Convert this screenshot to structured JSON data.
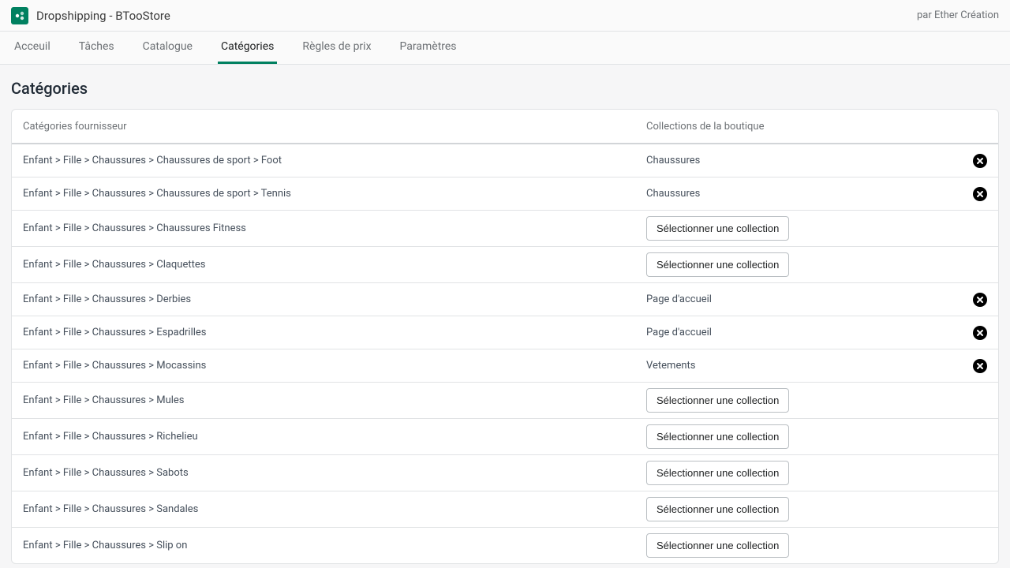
{
  "header": {
    "app_title": "Dropshipping - BTooStore",
    "author": "par Ether Création"
  },
  "tabs": [
    "Acceuil",
    "Tâches",
    "Catalogue",
    "Catégories",
    "Règles de prix",
    "Paramètres"
  ],
  "page_title": "Catégories",
  "columns": {
    "supplier": "Catégories fournisseur",
    "collection": "Collections de la boutique"
  },
  "select_label": "Sélectionner une collection",
  "rows": [
    {
      "supplier": "Enfant > Fille > Chaussures > Chaussures de sport > Foot",
      "collection": "Chaussures",
      "has_remove": true
    },
    {
      "supplier": "Enfant > Fille > Chaussures > Chaussures de sport > Tennis",
      "collection": "Chaussures",
      "has_remove": true
    },
    {
      "supplier": "Enfant > Fille > Chaussures > Chaussures Fitness",
      "collection": null,
      "has_remove": false
    },
    {
      "supplier": "Enfant > Fille > Chaussures > Claquettes",
      "collection": null,
      "has_remove": false
    },
    {
      "supplier": "Enfant > Fille > Chaussures > Derbies",
      "collection": "Page d'accueil",
      "has_remove": true
    },
    {
      "supplier": "Enfant > Fille > Chaussures > Espadrilles",
      "collection": "Page d'accueil",
      "has_remove": true
    },
    {
      "supplier": "Enfant > Fille > Chaussures > Mocassins",
      "collection": "Vetements",
      "has_remove": true
    },
    {
      "supplier": "Enfant > Fille > Chaussures > Mules",
      "collection": null,
      "has_remove": false
    },
    {
      "supplier": "Enfant > Fille > Chaussures > Richelieu",
      "collection": null,
      "has_remove": false
    },
    {
      "supplier": "Enfant > Fille > Chaussures > Sabots",
      "collection": null,
      "has_remove": false
    },
    {
      "supplier": "Enfant > Fille > Chaussures > Sandales",
      "collection": null,
      "has_remove": false
    },
    {
      "supplier": "Enfant > Fille > Chaussures > Slip on",
      "collection": null,
      "has_remove": false
    }
  ]
}
